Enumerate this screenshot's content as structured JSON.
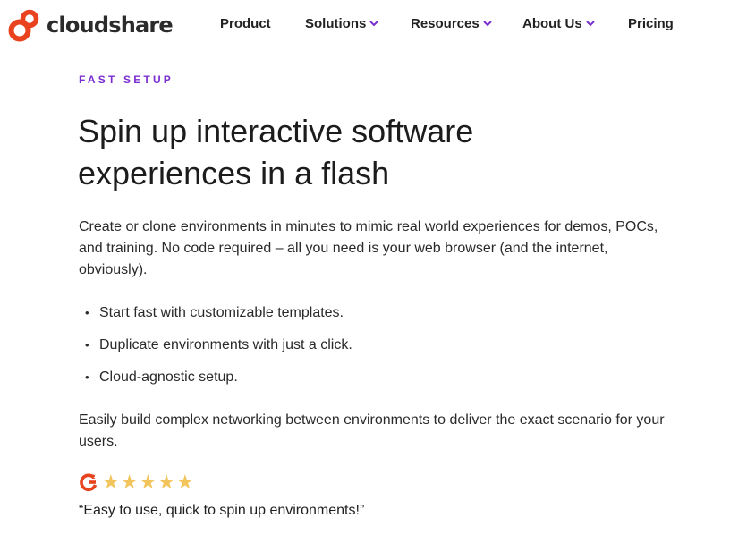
{
  "brand": {
    "name": "cloudshare",
    "logo_color": "#e8431e"
  },
  "nav": {
    "items": [
      {
        "label": "Product",
        "dropdown": false
      },
      {
        "label": "Solutions",
        "dropdown": true
      },
      {
        "label": "Resources",
        "dropdown": true
      },
      {
        "label": "About Us",
        "dropdown": true
      },
      {
        "label": "Pricing",
        "dropdown": false
      }
    ],
    "chevron_color": "#7b2fd1"
  },
  "hero": {
    "eyebrow": "FAST SETUP",
    "headline": "Spin up interactive software experiences in a flash",
    "intro": "Create or clone environments in minutes to mimic real world experiences for demos, POCs, and training. No code required – all you need is your web browser (and the internet, obviously).",
    "bullets": [
      "Start fast with customizable templates.",
      "Duplicate environments with just a click.",
      "Cloud-agnostic setup."
    ],
    "closing": "Easily build complex networking between environments to deliver the exact scenario for your users."
  },
  "review": {
    "source_icon": "g2-icon",
    "rating": 5,
    "max_rating": 5,
    "star_color": "#f2c55c",
    "quote": "“Easy to use, quick to spin up environments!”"
  },
  "colors": {
    "accent": "#7b2fd1",
    "brand": "#e8431e",
    "text": "#1f1f1f"
  }
}
